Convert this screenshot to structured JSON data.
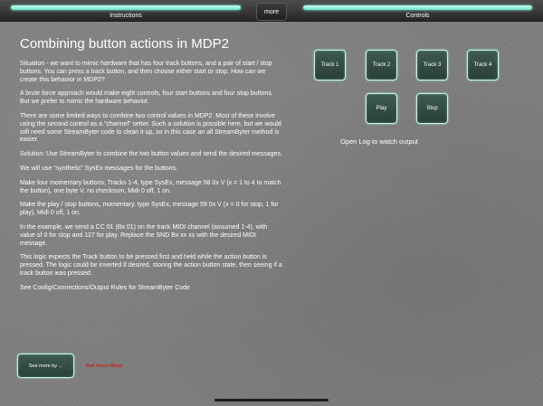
{
  "tabs": {
    "left_label": "Instructions",
    "right_label": "Controls",
    "more_label": "more"
  },
  "instructions": {
    "title": "Combining button actions in MDP2",
    "paragraphs": [
      "Situation - we want to mimic hardware that has four track buttons, and a pair of start / stop buttons. You can press a track button, and then choose either start or stop. How can we create this behavior in MDP2?",
      "A brute force approach would make eight controls, four start buttons and four stop buttons. But we prefer to mimic the hardware behavior.",
      "There are some limited ways to combine two control values in MDP2. Most of these involve using the second control as a \"channel\" setter. Such a solution is possible here, but we would still need some StreamByter code to clean it up, so in this case an all StreamByter method is easier.",
      "Solution: Use StreamByter to combine the two button values and send the desired messages.",
      "We will use \"synthetic\" SysEx messages for the buttons.",
      "Make four momentary buttons, Tracks 1-4, type SysEx, message 58 0x V (x = 1 to 4 to match the button), one byte V, no checksum, Midi 0 off, 1 on.",
      "Make the play / stop buttons, momentary, type SysEx, message 59 0x V (x = 0 for stop, 1 for play), Midi 0 off, 1 on.",
      "In the example, we send a CC 01 (Bx 01) on the track MIDI channel (assumed 1-4), with value of 0 for stop and 127 for play. Replace the SND Bx xx xx with the desired MIDI message.",
      "This logic expects the Track button to be pressed first and held while the action button is pressed. The logic could be inverted if desired, storing the action button state, then seeing if a track button was pressed.",
      "See Config/Connections/Output Rules for StreamByter Code"
    ]
  },
  "controls": {
    "track_buttons": [
      "Track 1",
      "Track 2",
      "Track 3",
      "Track 4"
    ],
    "play_label": "Play",
    "stop_label": "Stop",
    "log_text": "Open Log to watch output"
  },
  "footer": {
    "see_more_label": "See more by ...",
    "brand_text": "Red Heron Music"
  },
  "colors": {
    "accent_glow": "#7ff0d4",
    "button_border": "#c9f3e4",
    "brand_red": "#c8251e"
  }
}
